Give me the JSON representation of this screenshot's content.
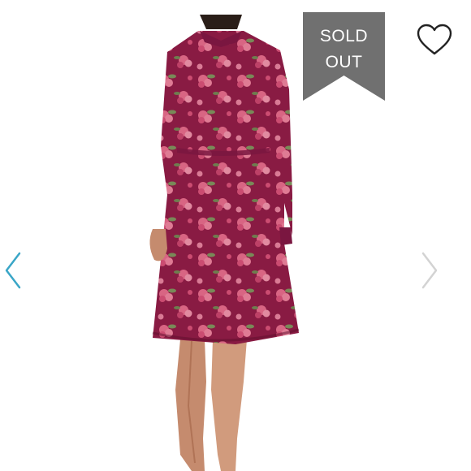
{
  "listing": {
    "badge": {
      "line1": "SOLD",
      "line2": "OUT",
      "color": "#707070"
    },
    "like_icon": "heart-outline-icon",
    "prev_icon": "chevron-left-icon",
    "next_icon": "chevron-right-icon",
    "colors": {
      "arrow_active": "#3aa6c7",
      "arrow_inactive": "#d3d3d3",
      "dress": "#8e1d46",
      "flower": "#e8718f"
    }
  }
}
